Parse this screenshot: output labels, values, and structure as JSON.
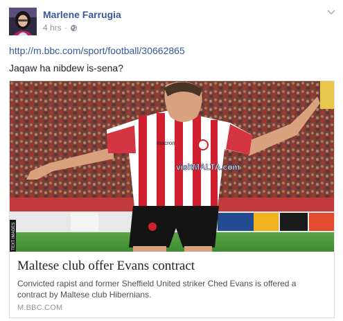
{
  "post": {
    "author": "Marlene Farrugia",
    "time": "4 hrs",
    "separator": "·",
    "privacy_icon": "globe-icon",
    "menu_icon": "chevron-down-icon",
    "link_url": "http://m.bbc.com/sport/football/30662865",
    "message": "Jaqaw ha nibdew is-sena?"
  },
  "card": {
    "title": "Maltese club offer Evans contract",
    "description": "Convicted rapist and former Sheffield United striker Ched Evans is offered a contract by Maltese club Hibernians.",
    "domain": "M.BBC.COM",
    "photo": {
      "shirt_sponsor": "visitMALTA.com",
      "kit_brand": "macron",
      "side_credit": "TEXT IMAGES"
    }
  },
  "colors": {
    "link": "#365899",
    "meta": "#90949c",
    "text": "#1d2129",
    "shirt_red": "#d01f2f",
    "pitch": "#4f9a3a"
  }
}
